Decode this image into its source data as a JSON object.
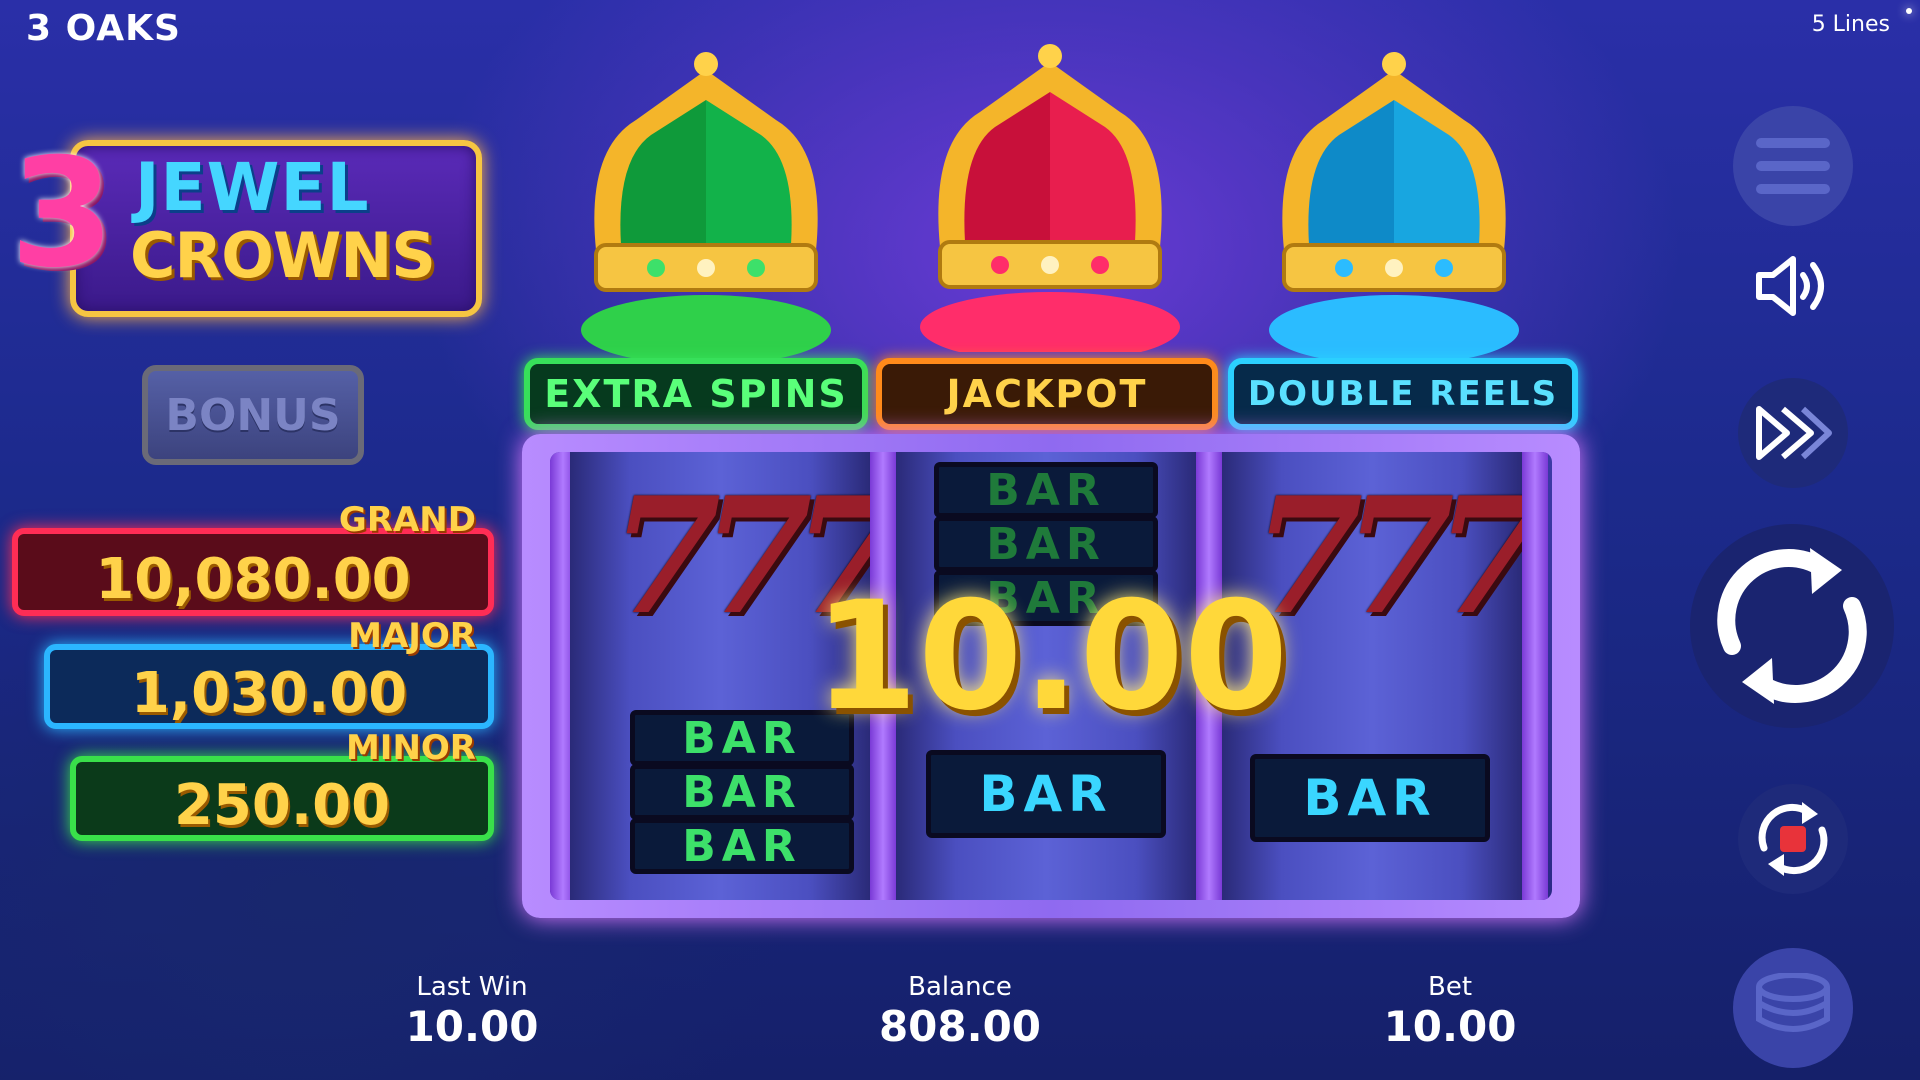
{
  "header": {
    "brand": "3 OAKS",
    "lines": "5 Lines"
  },
  "logo": {
    "number": "3",
    "word1": "JEWEL",
    "word2": "CROWNS"
  },
  "bonus": {
    "label": "BONUS"
  },
  "jackpots": [
    {
      "name": "GRAND",
      "value": "10,080.00",
      "color": "#ff2d55"
    },
    {
      "name": "MAJOR",
      "value": "1,030.00",
      "color": "#2bb6ff"
    },
    {
      "name": "MINOR",
      "value": "250.00",
      "color": "#39e04a"
    }
  ],
  "features": [
    {
      "label": "EXTRA SPINS",
      "crown": "green-crown-icon"
    },
    {
      "label": "JACKPOT",
      "crown": "red-crown-icon"
    },
    {
      "label": "DOUBLE REELS",
      "crown": "blue-crown-icon"
    }
  ],
  "reels": {
    "reel1": [
      "777",
      "BAR",
      "BAR",
      "BAR"
    ],
    "reel2": [
      "BAR",
      "BAR",
      "BAR",
      "BAR"
    ],
    "reel3": [
      "777",
      "BAR"
    ],
    "bar_label": "BAR",
    "seven_label": "777"
  },
  "win_display": "10.00",
  "stats": {
    "last_win": {
      "label": "Last Win",
      "value": "10.00"
    },
    "balance": {
      "label": "Balance",
      "value": "808.00"
    },
    "bet": {
      "label": "Bet",
      "value": "10.00"
    }
  },
  "controls": {
    "menu": "hamburger-menu-icon",
    "sound": "speaker-icon",
    "turbo": "fast-forward-icon",
    "spin": "spin-icon",
    "autoplay": "autoplay-stop-icon",
    "bet": "coin-stack-icon"
  },
  "colors": {
    "grand": "#ff2d55",
    "major": "#2bb6ff",
    "minor": "#39e04a",
    "gold": "#ffd24a"
  }
}
